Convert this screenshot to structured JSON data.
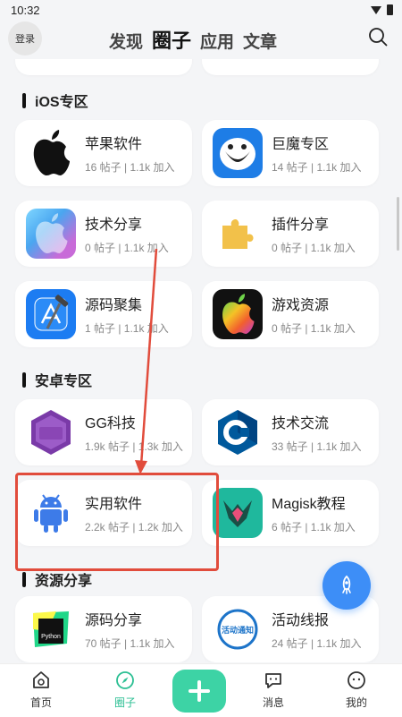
{
  "status_bar": {
    "time": "10:32"
  },
  "header": {
    "login_label": "登录",
    "tabs": [
      {
        "label": "发现"
      },
      {
        "label": "圈子"
      },
      {
        "label": "应用"
      },
      {
        "label": "文章"
      }
    ]
  },
  "sections": [
    {
      "title": "iOS专区",
      "cards": [
        {
          "name": "苹果软件",
          "stats": "16 帖子 | 1.1k 加入",
          "icon": "apple-logo-icon"
        },
        {
          "name": "巨魔专区",
          "stats": "14 帖子 | 1.1k 加入",
          "icon": "trollface-icon"
        },
        {
          "name": "技术分享",
          "stats": "0 帖子 | 1.1k 加入",
          "icon": "apple-gradient-icon"
        },
        {
          "name": "插件分享",
          "stats": "0 帖子 | 1.1k 加入",
          "icon": "puzzle-piece-icon"
        },
        {
          "name": "源码聚集",
          "stats": "1 帖子 | 1.1k 加入",
          "icon": "xcode-hammer-icon"
        },
        {
          "name": "游戏资源",
          "stats": "0 帖子 | 1.1k 加入",
          "icon": "colorful-apple-icon"
        }
      ]
    },
    {
      "title": "安卓专区",
      "cards": [
        {
          "name": "GG科技",
          "stats": "1.9k 帖子 | 1.3k 加入",
          "icon": "gg-hw-icon"
        },
        {
          "name": "技术交流",
          "stats": "33 帖子 | 1.1k 加入",
          "icon": "cpp-icon"
        },
        {
          "name": "实用软件",
          "stats": "2.2k 帖子 | 1.2k 加入",
          "icon": "android-robot-icon"
        },
        {
          "name": "Magisk教程",
          "stats": "6 帖子 | 1.1k 加入",
          "icon": "magisk-icon"
        }
      ]
    },
    {
      "title": "资源分享",
      "cards": [
        {
          "name": "源码分享",
          "stats": "70 帖子 | 1.1k 加入",
          "icon": "python-ide-icon",
          "badge": "Python"
        },
        {
          "name": "活动线报",
          "stats": "24 帖子 | 1.1k 加入",
          "icon": "activity-notice-icon",
          "badge": "活动通知"
        }
      ]
    }
  ],
  "bottom_nav": [
    {
      "label": "首页"
    },
    {
      "label": "圈子"
    },
    {
      "label": "消息"
    },
    {
      "label": "我的"
    }
  ],
  "colors": {
    "accent": "#2bbf93",
    "fab": "#3d8ef7",
    "annotation": "#e14c3c",
    "background": "#f4f5f7"
  }
}
